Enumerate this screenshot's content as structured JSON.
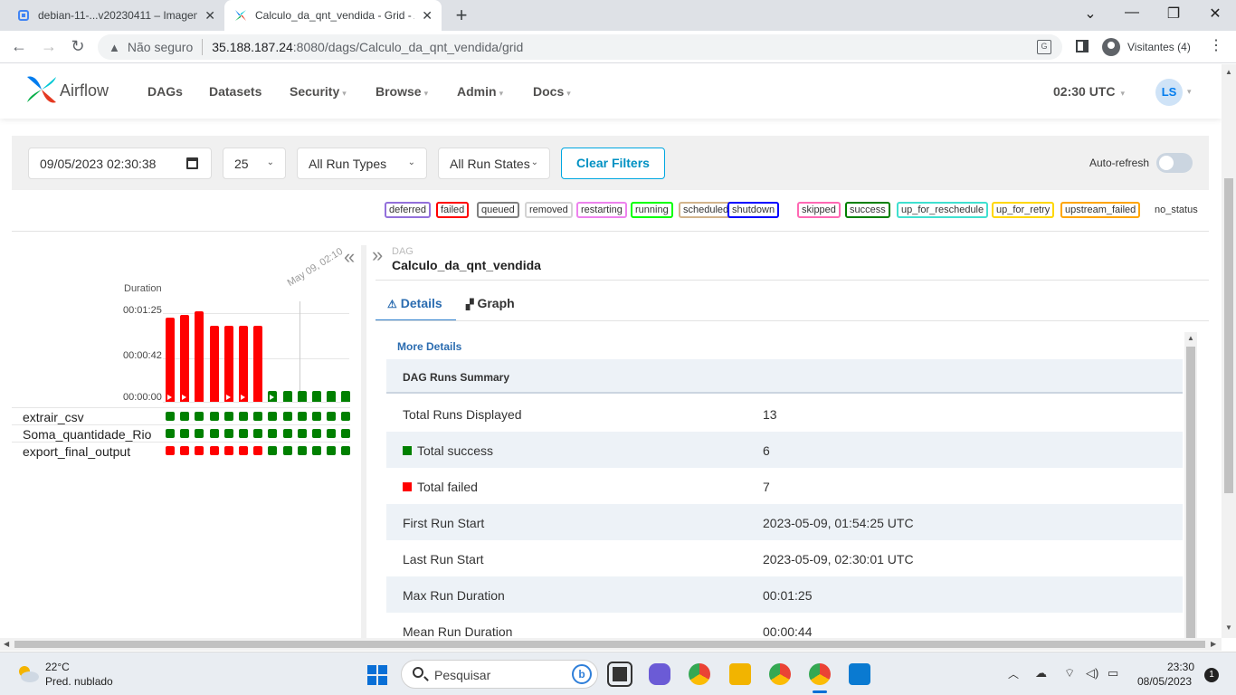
{
  "browser": {
    "tabs": [
      {
        "title": "debian-11-...v20230411 – Imagem",
        "close": "✕"
      },
      {
        "title": "Calculo_da_qnt_vendida - Grid - Airflow",
        "close": "✕"
      }
    ],
    "new_tab": "+",
    "window": {
      "minimize": "⌄",
      "restore": "—",
      "maximize": "❐",
      "close": "✕"
    },
    "nav": {
      "back": "←",
      "forward": "→",
      "reload": "↻"
    },
    "security_label": "Não seguro",
    "url_host": "35.188.187.24",
    "url_rest": ":8080/dags/Calculo_da_qnt_vendida/grid",
    "profile": "Visitantes (4)",
    "menu": "⋮"
  },
  "airflow": {
    "brand": "Airflow",
    "menu": [
      {
        "label": "DAGs",
        "caret": ""
      },
      {
        "label": "Datasets",
        "caret": ""
      },
      {
        "label": "Security",
        "caret": "▾"
      },
      {
        "label": "Browse",
        "caret": "▾"
      },
      {
        "label": "Admin",
        "caret": "▾"
      },
      {
        "label": "Docs",
        "caret": "▾"
      }
    ],
    "clock": "02:30 UTC",
    "user_initials": "LS",
    "caret": "▾"
  },
  "filters": {
    "date": "09/05/2023  02:30:38",
    "num_runs": "25",
    "run_type": "All Run Types",
    "run_state": "All Run States",
    "clear": "Clear Filters",
    "auto_refresh": "Auto-refresh",
    "auto_refresh_on": false
  },
  "legend": [
    {
      "label": "deferred",
      "color": "#9370db"
    },
    {
      "label": "failed",
      "color": "#ff0000"
    },
    {
      "label": "queued",
      "color": "#808080"
    },
    {
      "label": "removed",
      "color": "#d3d3d3"
    },
    {
      "label": "restarting",
      "color": "#ee82ee"
    },
    {
      "label": "running",
      "color": "#00ff00"
    },
    {
      "label": "scheduled",
      "color": "#d2b48c"
    },
    {
      "label": "shutdown",
      "color": "#0000ff"
    },
    {
      "label": "skipped",
      "color": "#ff69b4"
    },
    {
      "label": "success",
      "color": "#008000"
    },
    {
      "label": "up_for_reschedule",
      "color": "#40e0d0"
    },
    {
      "label": "up_for_retry",
      "color": "#ffd700"
    },
    {
      "label": "upstream_failed",
      "color": "#ffa500"
    },
    {
      "label": "no_status",
      "color": ""
    }
  ],
  "grid": {
    "duration_label": "Duration",
    "ticks": [
      "00:01:25",
      "00:00:42",
      "00:00:00"
    ],
    "date_tick": "May 09, 02:10",
    "collapse": "«",
    "run_durations_sec": [
      79,
      82,
      85,
      71,
      71,
      71,
      71,
      10,
      10,
      10,
      10,
      10,
      10
    ],
    "run_states": [
      "failed",
      "failed",
      "failed",
      "failed",
      "failed",
      "failed",
      "failed",
      "success",
      "success",
      "success",
      "success",
      "success",
      "success"
    ],
    "run_manual": [
      true,
      true,
      false,
      false,
      true,
      true,
      false,
      true,
      false,
      false,
      false,
      false,
      false
    ],
    "tasks": [
      {
        "name": "extrair_csv",
        "states": [
          "success",
          "success",
          "success",
          "success",
          "success",
          "success",
          "success",
          "success",
          "success",
          "success",
          "success",
          "success",
          "success"
        ]
      },
      {
        "name": "Soma_quantidade_Rio",
        "states": [
          "success",
          "success",
          "success",
          "success",
          "success",
          "success",
          "success",
          "success",
          "success",
          "success",
          "success",
          "success",
          "success"
        ]
      },
      {
        "name": "export_final_output",
        "states": [
          "failed",
          "failed",
          "failed",
          "failed",
          "failed",
          "failed",
          "failed",
          "success",
          "success",
          "success",
          "success",
          "success",
          "success"
        ]
      }
    ],
    "state_colors": {
      "success": "#008000",
      "failed": "#ff0000"
    }
  },
  "details": {
    "expand": "»",
    "dag_label": "DAG",
    "dag_id": "Calculo_da_qnt_vendida",
    "tab_details": "Details",
    "tab_graph": "Graph",
    "more_details": "More Details",
    "summary_title": "DAG Runs Summary",
    "rows": [
      {
        "key": "Total Runs Displayed",
        "value": "13",
        "swatch": ""
      },
      {
        "key": "Total success",
        "value": "6",
        "swatch": "#008000"
      },
      {
        "key": "Total failed",
        "value": "7",
        "swatch": "#ff0000"
      },
      {
        "key": "First Run Start",
        "value": "2023-05-09, 01:54:25 UTC",
        "swatch": ""
      },
      {
        "key": "Last Run Start",
        "value": "2023-05-09, 02:30:01 UTC",
        "swatch": ""
      },
      {
        "key": "Max Run Duration",
        "value": "00:01:25",
        "swatch": ""
      },
      {
        "key": "Mean Run Duration",
        "value": "00:00:44",
        "swatch": ""
      }
    ]
  },
  "taskbar": {
    "temp": "22°C",
    "weather": "Pred. nublado",
    "search": "Pesquisar",
    "time": "23:30",
    "date": "08/05/2023",
    "notifications": "1"
  }
}
